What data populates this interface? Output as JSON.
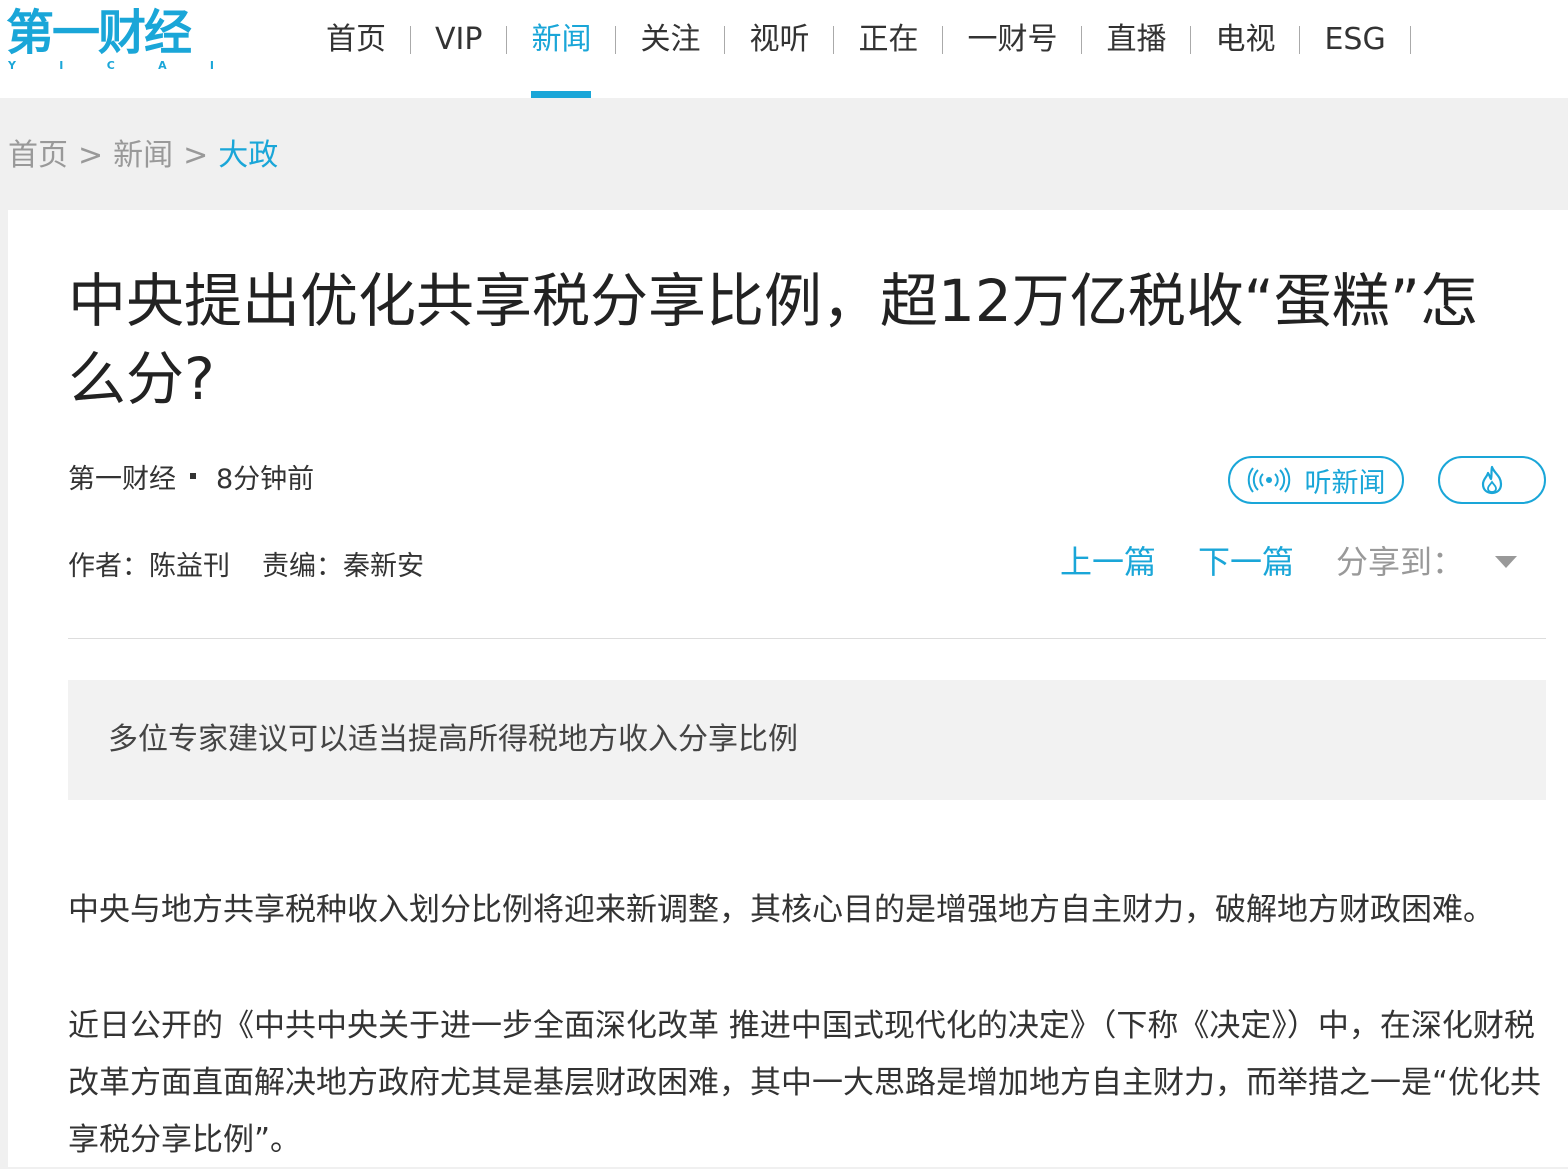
{
  "logo": {
    "main": "第一财经",
    "sub": [
      "Y",
      "I",
      "C",
      "A",
      "I"
    ]
  },
  "nav": {
    "items": [
      {
        "label": "首页",
        "active": false
      },
      {
        "label": "VIP",
        "active": false
      },
      {
        "label": "新闻",
        "active": true
      },
      {
        "label": "关注",
        "active": false
      },
      {
        "label": "视听",
        "active": false
      },
      {
        "label": "正在",
        "active": false
      },
      {
        "label": "一财号",
        "active": false
      },
      {
        "label": "直播",
        "active": false
      },
      {
        "label": "电视",
        "active": false
      },
      {
        "label": "ESG",
        "active": false
      }
    ]
  },
  "breadcrumb": {
    "items": [
      "首页",
      "新闻",
      "大政"
    ],
    "separator": ">"
  },
  "article": {
    "title": "中央提出优化共享税分享比例，超12万亿税收“蛋糕”怎么分?",
    "source": "第一财经",
    "time": "8分钟前",
    "listen_label": "听新闻",
    "author": "作者：陈益刊",
    "editor": "责编：秦新安",
    "prev_label": "上一篇",
    "next_label": "下一篇",
    "share_label": "分享到：",
    "summary": "多位专家建议可以适当提高所得税地方收入分享比例",
    "paragraphs": [
      "中央与地方共享税种收入划分比例将迎来新调整，其核心目的是增强地方自主财力，破解地方财政困难。",
      "近日公开的《中共中央关于进一步全面深化改革 推进中国式现代化的决定》（下称《决定》）中，在深化财税改革方面直面解决地方政府尤其是基层财政困难，其中一大思路是增加地方自主财力，而举措之一是“优化共享税分享比例”。"
    ]
  },
  "colors": {
    "accent": "#1aa6d8",
    "text": "#333333",
    "muted": "#999999",
    "background": "#f0f0f0"
  },
  "icons": {
    "listen": "broadcast-icon",
    "hot": "flame-icon",
    "share_dropdown": "caret-down-icon"
  }
}
